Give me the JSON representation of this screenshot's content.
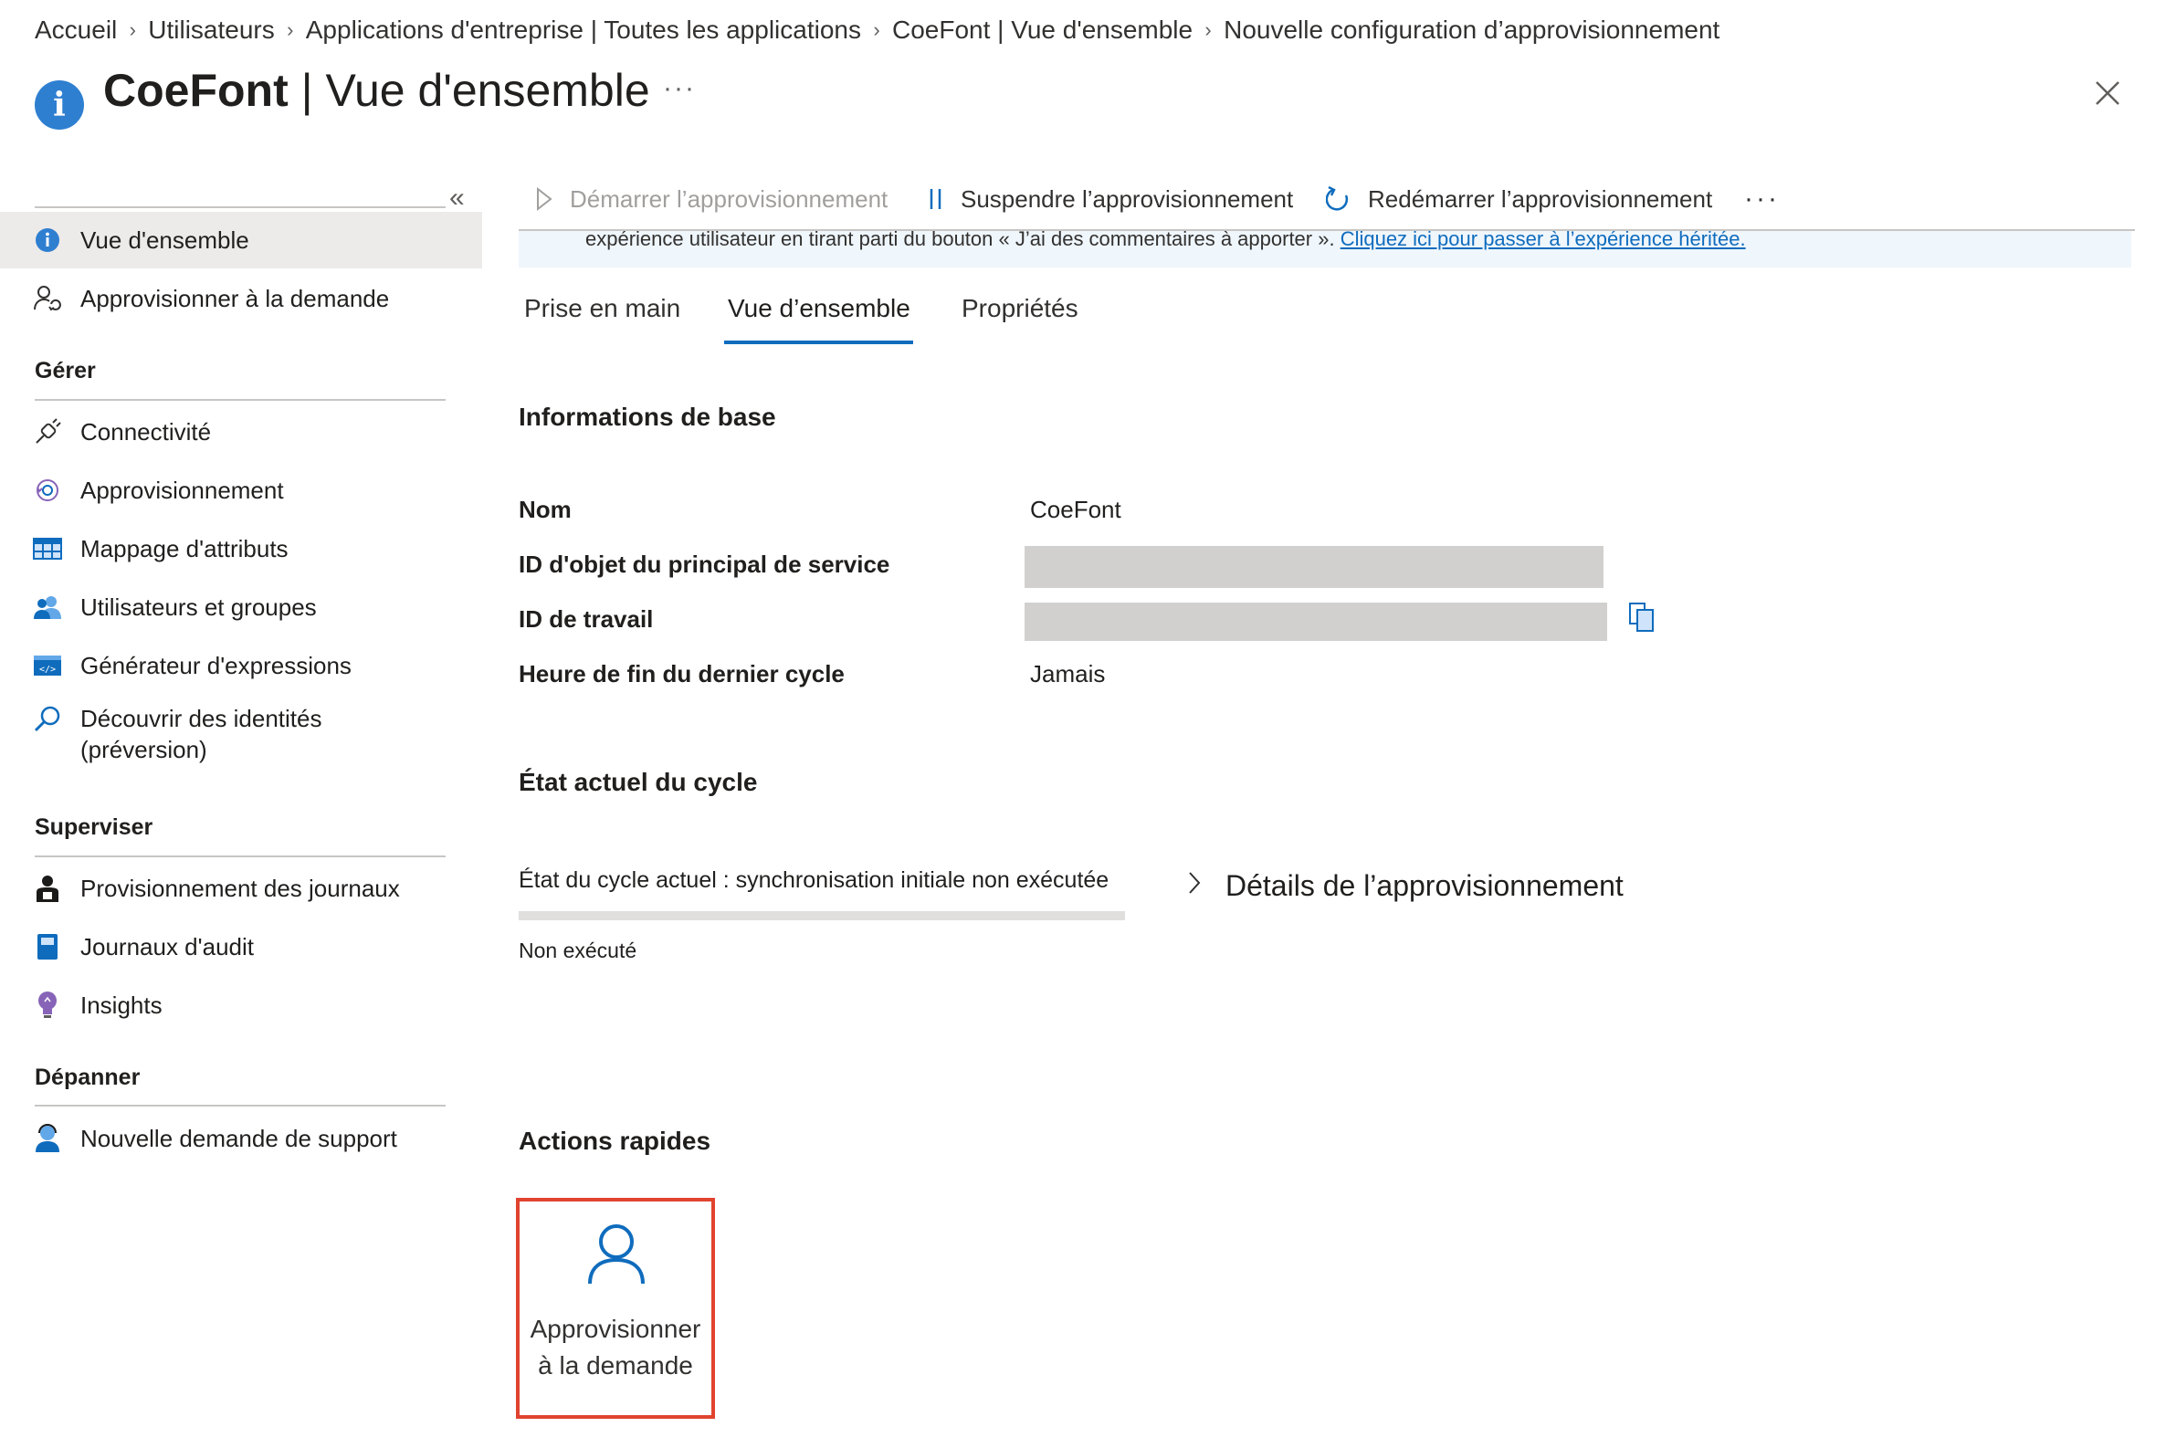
{
  "breadcrumb": [
    "Accueil",
    "Utilisateurs",
    "Applications d'entreprise | Toutes les applications",
    "CoeFont | Vue d'ensemble",
    "Nouvelle configuration d’approvisionnement"
  ],
  "header": {
    "title_bold": "CoeFont",
    "title_rest": " | Vue d'ensemble",
    "more": "···"
  },
  "sidebar": {
    "collapse": "«",
    "items_top": [
      {
        "label": "Vue d'ensemble",
        "icon": "info-icon",
        "active": true
      },
      {
        "label": "Approvisionner à la demande",
        "icon": "user-sync-icon"
      }
    ],
    "section_manage": "Gérer",
    "items_manage": [
      {
        "label": "Connectivité",
        "icon": "plug-icon"
      },
      {
        "label": "Approvisionnement",
        "icon": "sync-icon"
      },
      {
        "label": "Mappage d'attributs",
        "icon": "table-icon"
      },
      {
        "label": "Utilisateurs et groupes",
        "icon": "users-icon"
      },
      {
        "label": "Générateur d'expressions",
        "icon": "code-icon"
      },
      {
        "label": "Découvrir des identités",
        "label2": "(préversion)",
        "icon": "search-icon"
      }
    ],
    "section_monitor": "Superviser",
    "items_monitor": [
      {
        "label": "Provisionnement des journaux",
        "icon": "user-log-icon"
      },
      {
        "label": "Journaux d'audit",
        "icon": "book-icon"
      },
      {
        "label": "Insights",
        "icon": "lightbulb-icon"
      }
    ],
    "section_troubleshoot": "Dépanner",
    "items_troubleshoot": [
      {
        "label": "Nouvelle demande de support",
        "icon": "support-icon"
      }
    ]
  },
  "toolbar": {
    "start": "Démarrer l’approvisionnement",
    "pause": "Suspendre l’approvisionnement",
    "restart": "Redémarrer l’approvisionnement",
    "more": "···"
  },
  "banner": {
    "text": "expérience utilisateur en tirant parti du bouton « J’ai des commentaires à apporter ». ",
    "link": "Cliquez ici pour passer à l’expérience héritée."
  },
  "tabs": [
    "Prise en main",
    "Vue d’ensemble",
    "Propriétés"
  ],
  "active_tab": "Vue d’ensemble",
  "basic_info": {
    "heading": "Informations de base",
    "rows": [
      {
        "label": "Nom",
        "value": "CoeFont"
      },
      {
        "label": "ID d'objet du principal de service",
        "value": ""
      },
      {
        "label": "ID de travail",
        "value": ""
      },
      {
        "label": "Heure de fin du dernier cycle",
        "value": "Jamais"
      }
    ]
  },
  "cycle": {
    "heading": "État actuel du cycle",
    "status_line": "État du cycle actuel : synchronisation initiale non exécutée",
    "progress": 0,
    "status": "Non exécuté",
    "details_link": "Détails de l’approvisionnement"
  },
  "quick_actions": {
    "heading": "Actions rapides",
    "tile_label": "Approvisionner à la demande"
  },
  "colors": {
    "accent": "#0f6cbd",
    "highlight_border": "#e0432f",
    "info_badge": "#2f7fd1"
  }
}
